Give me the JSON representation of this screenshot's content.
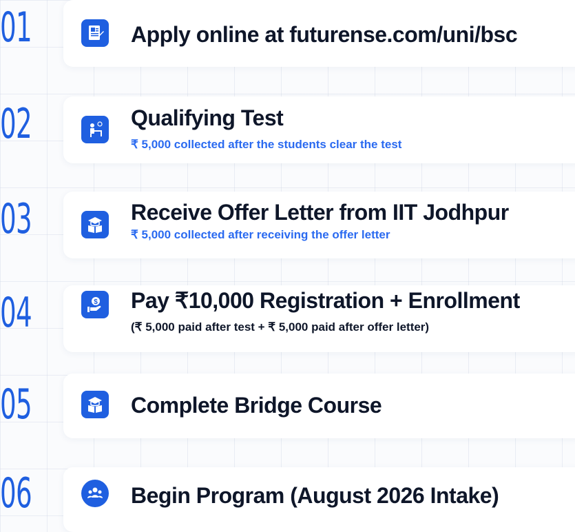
{
  "steps": [
    {
      "number": "01",
      "title": "Apply online at futurense.com/uni/bsc",
      "subtitle": "",
      "icon": "application-form-icon"
    },
    {
      "number": "02",
      "title": "Qualifying Test",
      "subtitle": "₹ 5,000 collected after the students clear the test",
      "icon": "student-test-icon"
    },
    {
      "number": "03",
      "title": "Receive Offer Letter from IIT Jodhpur",
      "subtitle": "₹ 5,000 collected after receiving the offer letter",
      "icon": "graduation-book-icon"
    },
    {
      "number": "04",
      "title": "Pay ₹10,000 Registration + Enrollment",
      "subtitle": "(₹ 5,000 paid after test + ₹ 5,000 paid after offer letter)",
      "icon": "payment-hand-icon"
    },
    {
      "number": "05",
      "title": "Complete Bridge Course",
      "subtitle": "",
      "icon": "graduation-book-icon"
    },
    {
      "number": "06",
      "title": "Begin Program (August 2026 Intake)",
      "subtitle": "",
      "icon": "group-people-icon"
    }
  ],
  "colors": {
    "accent": "#1f5fe0",
    "subtitle_blue": "#2a6af0",
    "title": "#0e1629"
  }
}
